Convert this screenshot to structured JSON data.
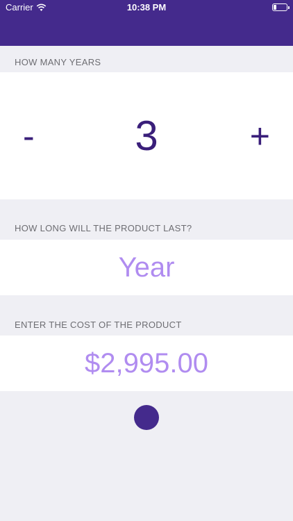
{
  "status_bar": {
    "carrier": "Carrier",
    "time": "10:38 PM",
    "battery_level": 0.25
  },
  "colors": {
    "nav_background": "#442A8C",
    "page_background": "#EFEFF4",
    "primary_text": "#3A1F7A",
    "value_text": "#B08CF0",
    "label_text": "#6D6D72"
  },
  "years": {
    "label": "HOW MANY YEARS",
    "value": "3",
    "minus_label": "-",
    "plus_label": "+"
  },
  "lifespan": {
    "label": "HOW LONG WILL THE PRODUCT LAST?",
    "value": "Year"
  },
  "cost": {
    "label": "ENTER THE COST OF THE PRODUCT",
    "value": "$2,995.00"
  }
}
